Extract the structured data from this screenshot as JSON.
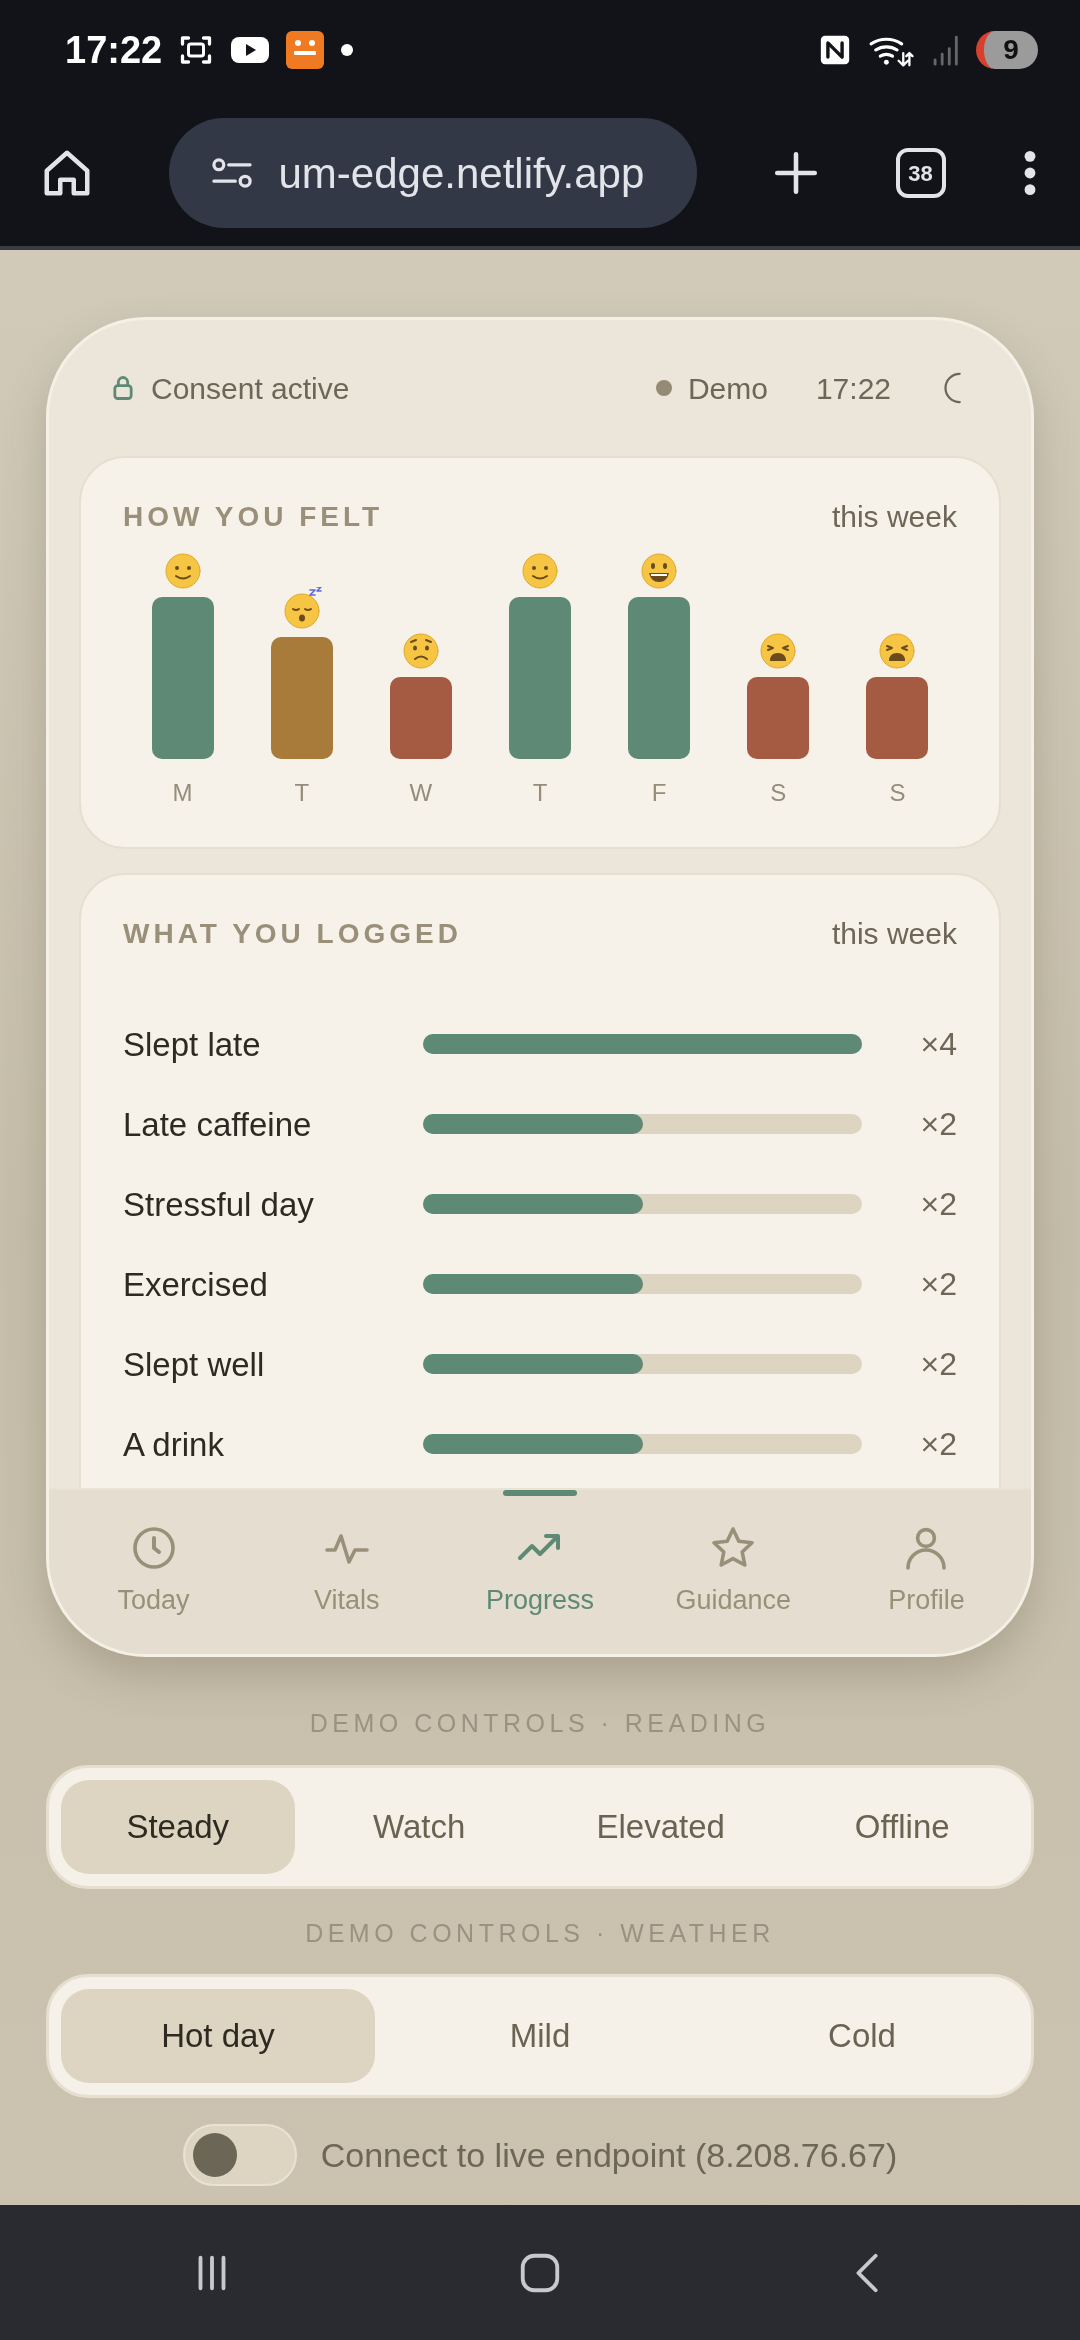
{
  "status_bar": {
    "time": "17:22",
    "battery": "9"
  },
  "browser": {
    "url": "um-edge.netlify.app",
    "tab_count": "38"
  },
  "header": {
    "consent": "Consent active",
    "mode": "Demo",
    "time": "17:22"
  },
  "mood_card": {
    "title": "HOW YOU FELT",
    "period": "this week",
    "days": [
      {
        "label": "M",
        "kind": "smile",
        "color": "#5e8a75"
      },
      {
        "label": "T",
        "kind": "sleepy",
        "color": "#a87b3a"
      },
      {
        "label": "W",
        "kind": "worried",
        "color": "#a55a42"
      },
      {
        "label": "T",
        "kind": "smile",
        "color": "#5e8a75"
      },
      {
        "label": "F",
        "kind": "grin",
        "color": "#5e8a75"
      },
      {
        "label": "S",
        "kind": "weary",
        "color": "#a55a42"
      },
      {
        "label": "S",
        "kind": "weary",
        "color": "#a55a42"
      }
    ]
  },
  "log_card": {
    "title": "WHAT YOU LOGGED",
    "period": "this week",
    "items": [
      {
        "label": "Slept late",
        "level": 1,
        "count": "×4"
      },
      {
        "label": "Late caffeine",
        "level": 0.5,
        "count": "×2"
      },
      {
        "label": "Stressful day",
        "level": 0.5,
        "count": "×2"
      },
      {
        "label": "Exercised",
        "level": 0.5,
        "count": "×2"
      },
      {
        "label": "Slept well",
        "level": 0.5,
        "count": "×2"
      },
      {
        "label": "A drink",
        "level": 0.5,
        "count": "×2"
      }
    ]
  },
  "tabs": [
    {
      "label": "Today",
      "kind": "clock",
      "selected": false
    },
    {
      "label": "Vitals",
      "kind": "pulse",
      "selected": false
    },
    {
      "label": "Progress",
      "kind": "trend",
      "selected": true
    },
    {
      "label": "Guidance",
      "kind": "star",
      "selected": false
    },
    {
      "label": "Profile",
      "kind": "person",
      "selected": false
    }
  ],
  "reading_controls": {
    "title": "DEMO CONTROLS · READING",
    "options": [
      {
        "label": "Steady",
        "selected": true
      },
      {
        "label": "Watch",
        "selected": false
      },
      {
        "label": "Elevated",
        "selected": false
      },
      {
        "label": "Offline",
        "selected": false
      }
    ]
  },
  "weather_controls": {
    "title": "DEMO CONTROLS · WEATHER",
    "options": [
      {
        "label": "Hot day",
        "selected": true
      },
      {
        "label": "Mild",
        "selected": false
      },
      {
        "label": "Cold",
        "selected": false
      }
    ]
  },
  "live_endpoint": {
    "label": "Connect to live endpoint (8.208.76.67)",
    "on": false
  }
}
